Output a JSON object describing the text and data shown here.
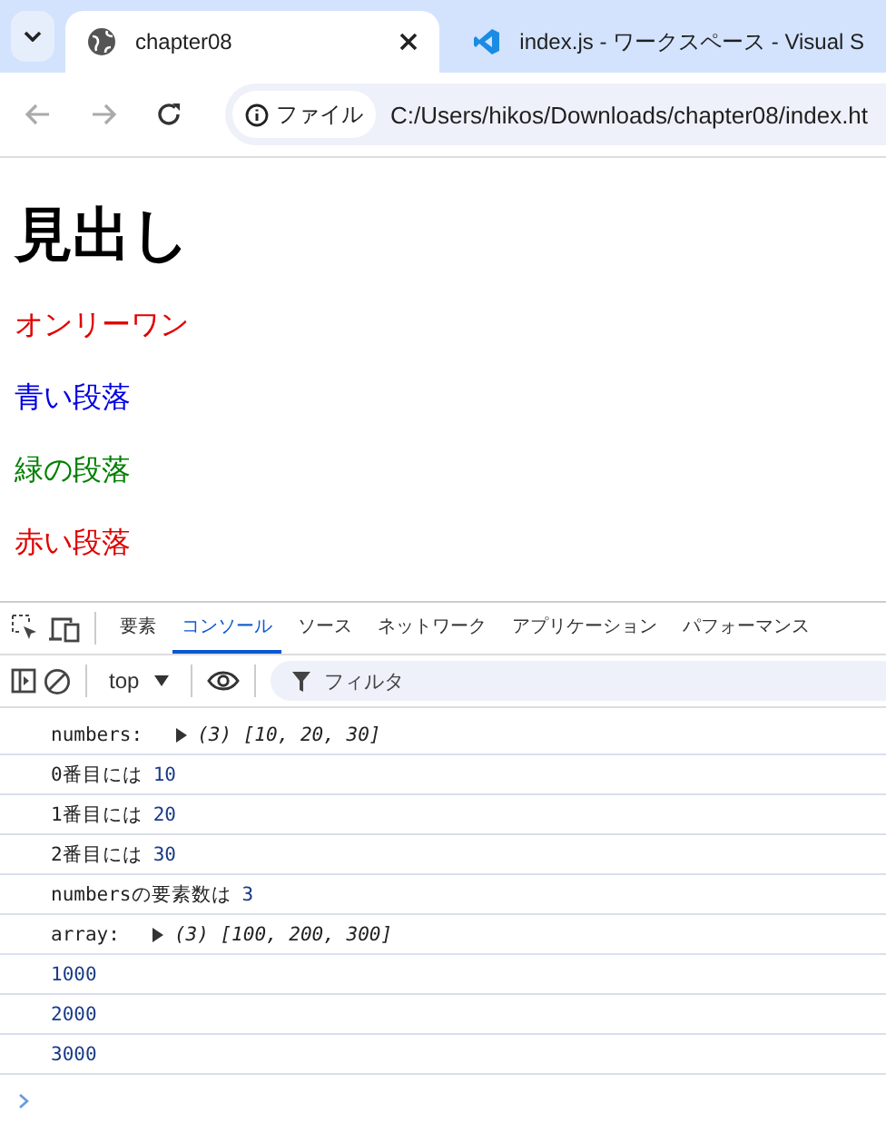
{
  "browser": {
    "tabs": [
      {
        "kind": "globe",
        "title": "chapter08",
        "selected": true
      },
      {
        "kind": "editor",
        "title": "index.js - ワークスペース - Visual S",
        "selected": false
      }
    ],
    "address": {
      "chip": "ファイル",
      "url": "C:/Users/hikos/Downloads/chapter08/index.ht"
    }
  },
  "page": {
    "heading": "見出し",
    "paragraphs": [
      {
        "text": "オンリーワン",
        "color": "#e00000"
      },
      {
        "text": "青い段落",
        "color": "#0000e0"
      },
      {
        "text": "緑の段落",
        "color": "#008000"
      },
      {
        "text": "赤い段落",
        "color": "#e00000"
      }
    ]
  },
  "devtools": {
    "tabs": [
      {
        "label": "要素",
        "selected": false
      },
      {
        "label": "コンソール",
        "selected": true
      },
      {
        "label": "ソース",
        "selected": false
      },
      {
        "label": "ネットワーク",
        "selected": false
      },
      {
        "label": "アプリケーション",
        "selected": false
      },
      {
        "label": "パフォーマンス",
        "selected": false
      }
    ],
    "context": "top",
    "filter": {
      "placeholder": "フィルタ"
    },
    "messages": [
      {
        "kind": "array",
        "label": "numbers:",
        "preview": "(3) [10, 20, 30]"
      },
      {
        "kind": "text_number",
        "text": "0番目には",
        "number": "10"
      },
      {
        "kind": "text_number",
        "text": "1番目には",
        "number": "20"
      },
      {
        "kind": "text_number",
        "text": "2番目には",
        "number": "30"
      },
      {
        "kind": "text_number",
        "text": "numbersの要素数は",
        "number": "3"
      },
      {
        "kind": "array",
        "label": "array:",
        "preview": "(3) [100, 200, 300]"
      },
      {
        "kind": "number",
        "number": "1000"
      },
      {
        "kind": "number",
        "number": "2000"
      },
      {
        "kind": "number",
        "number": "3000"
      }
    ]
  }
}
